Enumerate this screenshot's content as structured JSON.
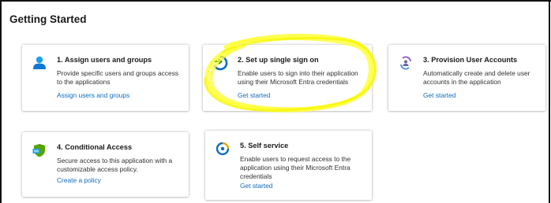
{
  "section_title": "Getting Started",
  "cards": [
    {
      "title": "1. Assign users and groups",
      "description": "Provide specific users and groups access to the applications",
      "link": "Assign users and groups",
      "icon": "user-icon"
    },
    {
      "title": "2. Set up single sign on",
      "description": "Enable users to sign into their application using their Microsoft Entra credentials",
      "link": "Get started",
      "icon": "sso-icon"
    },
    {
      "title": "3. Provision User Accounts",
      "description": "Automatically create and delete user accounts in the application",
      "link": "Get started",
      "icon": "provisioning-icon"
    },
    {
      "title": "4. Conditional Access",
      "description": "Secure access to this application with a customizable access policy.",
      "link": "Create a policy",
      "icon": "shield-icon"
    },
    {
      "title": "5. Self service",
      "description": "Enable users to request access to the application using their Microsoft Entra credentials",
      "link": "Get started",
      "icon": "self-service-icon"
    }
  ],
  "colors": {
    "link": "#0f6cbd",
    "highlight": "#ffff33"
  }
}
